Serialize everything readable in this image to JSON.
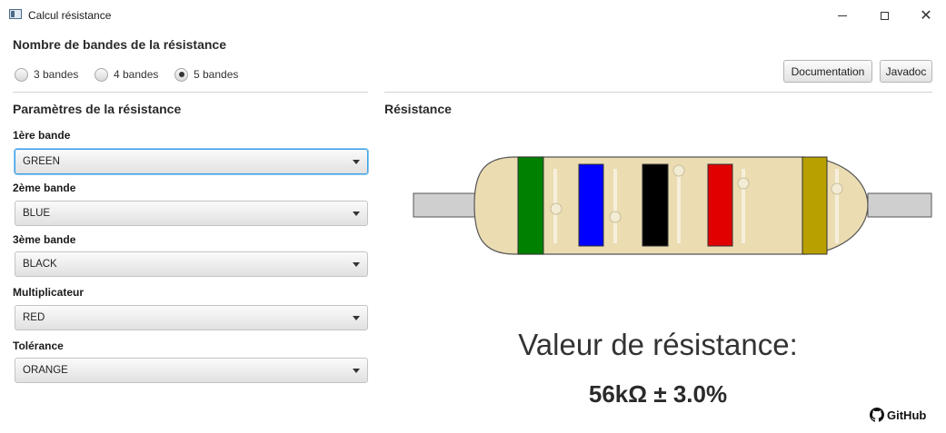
{
  "window": {
    "title": "Calcul résistance"
  },
  "band_count": {
    "title": "Nombre de bandes de la résistance",
    "options": [
      {
        "label": "3 bandes",
        "checked": false
      },
      {
        "label": "4 bandes",
        "checked": false
      },
      {
        "label": "5 bandes",
        "checked": true
      }
    ]
  },
  "toolbar": {
    "documentation_label": "Documentation",
    "javadoc_label": "Javadoc"
  },
  "params": {
    "title": "Paramètres de la résistance",
    "fields": [
      {
        "label": "1ère bande",
        "value": "GREEN",
        "focused": true
      },
      {
        "label": "2ème bande",
        "value": "BLUE",
        "focused": false
      },
      {
        "label": "3ème bande",
        "value": "BLACK",
        "focused": false
      },
      {
        "label": "Multiplicateur",
        "value": "RED",
        "focused": false
      },
      {
        "label": "Tolérance",
        "value": "ORANGE",
        "focused": false
      }
    ]
  },
  "resistor": {
    "title": "Résistance",
    "colors": {
      "body": "#ebdcb2",
      "band1": "#008000",
      "band2": "#0000ff",
      "band3": "#000000",
      "multiplier": "#e00000",
      "tolerance": "#b8a000",
      "lead": "#cfcfcf"
    }
  },
  "result": {
    "caption": "Valeur de résistance:",
    "value": "56kΩ ± 3.0%"
  },
  "footer": {
    "github_label": "GitHub",
    "icon": "github-icon"
  }
}
